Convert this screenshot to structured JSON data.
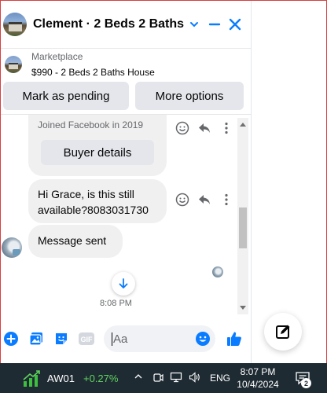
{
  "header": {
    "title": "Clement · 2 Beds 2 Baths ...",
    "avatar_icon": "house-photo",
    "chevron_icon": "chevron-down-icon",
    "minimize_icon": "minimize-icon",
    "close_icon": "close-icon"
  },
  "listing": {
    "source": "Marketplace",
    "title": "$990 - 2 Beds 2 Baths House"
  },
  "actions": {
    "mark_pending": "Mark as pending",
    "more_options": "More options"
  },
  "messages": {
    "card_joined": "Joined Facebook in 2019",
    "buyer_details": "Buyer details",
    "question": "Hi Grace, is this still available?8083031730",
    "sent": "Message sent",
    "timestamp": "8:08 PM"
  },
  "composer": {
    "placeholder": "Aa",
    "icons": [
      "add-circle-icon",
      "photo-icon",
      "sticker-icon",
      "gif-icon",
      "emoji-icon",
      "thumbs-up-icon"
    ]
  },
  "new_message_icon": "compose-icon",
  "taskbar": {
    "stock_symbol": "AW01",
    "stock_change": "+0.27%",
    "language": "ENG",
    "time": "8:07 PM",
    "date": "10/4/2024",
    "notification_count": "2"
  },
  "colors": {
    "accent": "#0a7cff",
    "bubble": "#f0f0f0",
    "taskbar": "#1f2b33",
    "stock_up": "#5fd35f"
  }
}
